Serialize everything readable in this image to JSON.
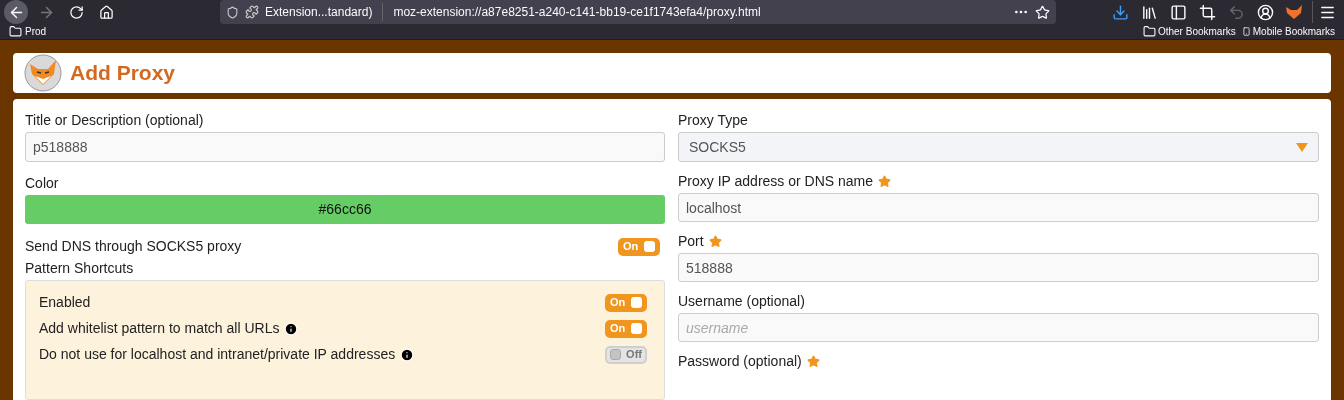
{
  "browser": {
    "back_disabled": false,
    "forward_disabled": true,
    "undo_disabled": true,
    "identity_label": "Extension...tandard)",
    "url": "moz-extension://a87e8251-a240-c141-bb19-ce1f1743efa4/proxy.html",
    "bookmarks_left": [
      {
        "label": "Prod",
        "kind": "folder"
      }
    ],
    "bookmarks_right": [
      {
        "label": "Other Bookmarks",
        "kind": "folder"
      },
      {
        "label": "Mobile Bookmarks",
        "kind": "mobile"
      }
    ]
  },
  "header": {
    "title": "Add Proxy"
  },
  "left": {
    "title_field": {
      "label": "Title or Description (optional)",
      "value": "p518888"
    },
    "color_field": {
      "label": "Color",
      "value": "#66cc66",
      "color": "#66cc66"
    },
    "dns_toggle": {
      "label": "Send DNS through SOCKS5 proxy",
      "on": true,
      "toggle_text": "On"
    },
    "pattern_shortcuts": {
      "label": "Pattern Shortcuts",
      "items": [
        {
          "label": "Enabled",
          "info": false,
          "on": true,
          "toggle_text": "On"
        },
        {
          "label": "Add whitelist pattern to match all URLs",
          "info": true,
          "on": true,
          "toggle_text": "On"
        },
        {
          "label": "Do not use for localhost and intranet/private IP addresses",
          "info": true,
          "on": false,
          "toggle_text": "Off"
        }
      ]
    }
  },
  "right": {
    "fields": [
      {
        "label": "Proxy Type",
        "kind": "select",
        "value": "SOCKS5",
        "required": false
      },
      {
        "label": "Proxy IP address or DNS name",
        "kind": "input",
        "value": "localhost",
        "required": true
      },
      {
        "label": "Port",
        "kind": "input",
        "value": "518888",
        "required": true
      },
      {
        "label": "Username (optional)",
        "kind": "input",
        "placeholder": "username",
        "required": false
      },
      {
        "label": "Password (optional)",
        "kind": "label",
        "required": true
      }
    ]
  }
}
